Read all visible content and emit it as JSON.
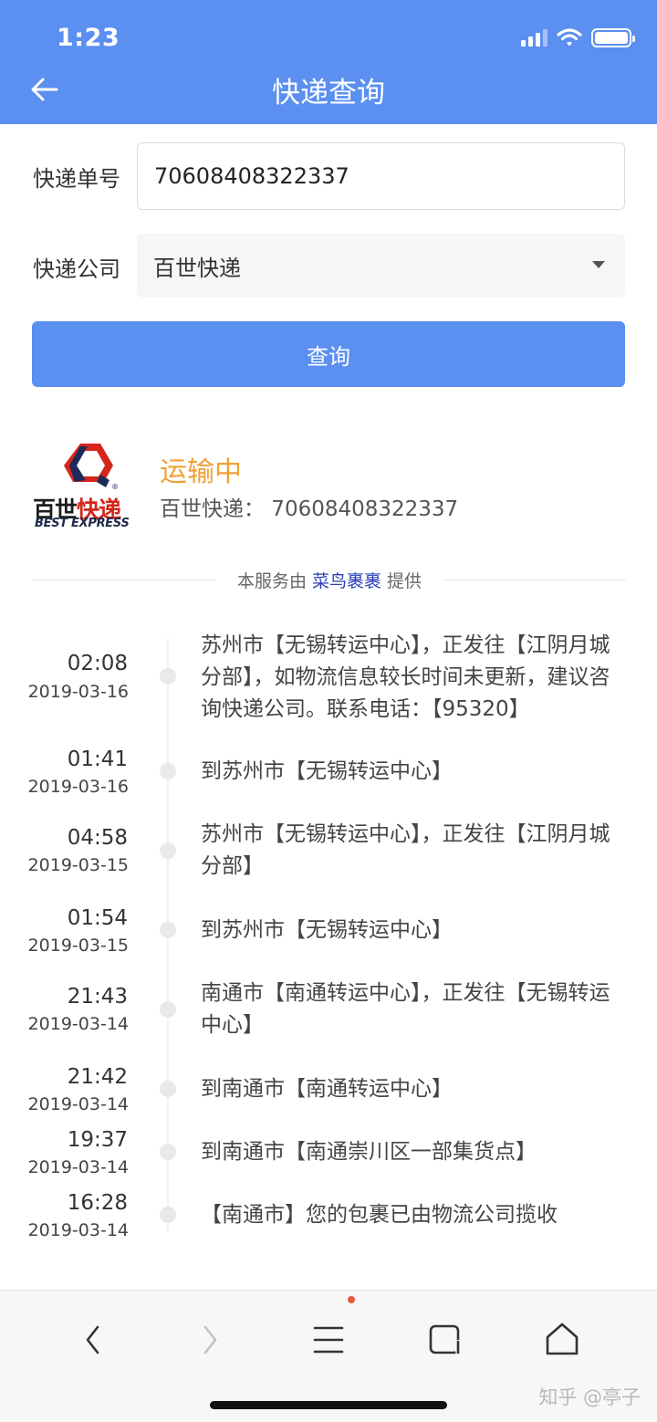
{
  "status_bar": {
    "time": "1:23"
  },
  "header": {
    "title": "快递查询"
  },
  "form": {
    "tracking_label": "快递单号",
    "tracking_value": "70608408322337",
    "company_label": "快递公司",
    "company_value": "百世快递",
    "query_button": "查询"
  },
  "result": {
    "logo_cn_part1": "百世",
    "logo_cn_part2": "快递",
    "logo_en": "BEST EXPRESS",
    "status": "运输中",
    "company_tracking": "百世快递：  70608408322337",
    "provider_prefix": "本服务由 ",
    "provider_name": "菜鸟裹裹",
    "provider_suffix": " 提供"
  },
  "timeline": [
    {
      "time": "02:08",
      "date": "2019-03-16",
      "desc": "苏州市【无锡转运中心】，正发往【江阴月城分部】，如物流信息较长时间未更新，建议咨询快递公司。联系电话：【95320】"
    },
    {
      "time": "01:41",
      "date": "2019-03-16",
      "desc": "到苏州市【无锡转运中心】"
    },
    {
      "time": "04:58",
      "date": "2019-03-15",
      "desc": "苏州市【无锡转运中心】，正发往【江阴月城分部】"
    },
    {
      "time": "01:54",
      "date": "2019-03-15",
      "desc": "到苏州市【无锡转运中心】"
    },
    {
      "time": "21:43",
      "date": "2019-03-14",
      "desc": "南通市【南通转运中心】，正发往【无锡转运中心】"
    },
    {
      "time": "21:42",
      "date": "2019-03-14",
      "desc": "到南通市【南通转运中心】"
    },
    {
      "time": "19:37",
      "date": "2019-03-14",
      "desc": "到南通市【南通崇川区一部集货点】"
    },
    {
      "time": "16:28",
      "date": "2019-03-14",
      "desc": "【南通市】您的包裹已由物流公司揽收"
    }
  ],
  "bottom_bar": {
    "icons": [
      "back-icon",
      "forward-icon",
      "menu-icon",
      "tabs-icon",
      "home-icon"
    ],
    "watermark": "知乎 @亭子"
  },
  "colors": {
    "accent": "#5b8ff0",
    "status": "#f0a038",
    "provider_link": "#2b3fb8"
  }
}
